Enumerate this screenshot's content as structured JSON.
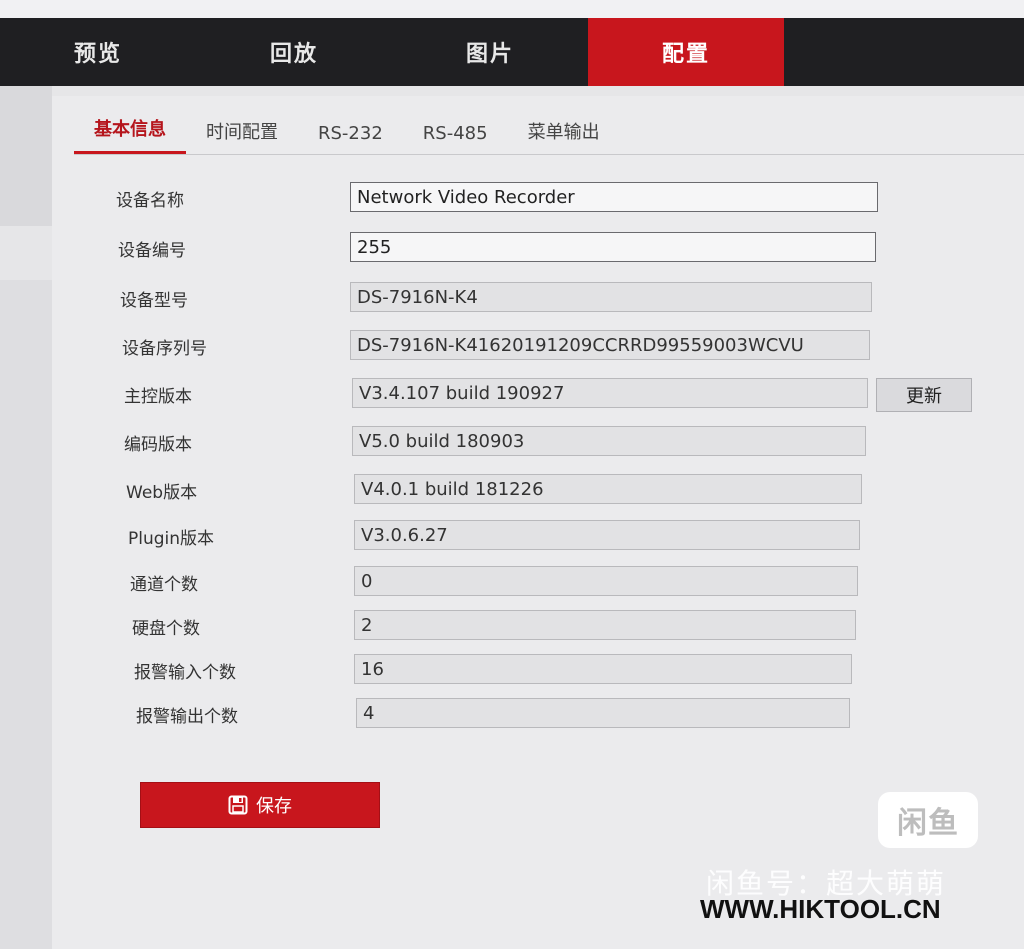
{
  "top_nav": {
    "items": [
      {
        "label": "预览",
        "active": false
      },
      {
        "label": "回放",
        "active": false
      },
      {
        "label": "图片",
        "active": false
      },
      {
        "label": "配置",
        "active": true
      }
    ]
  },
  "sub_tabs": [
    {
      "label": "基本信息",
      "active": true
    },
    {
      "label": "时间配置",
      "active": false
    },
    {
      "label": "RS-232",
      "active": false
    },
    {
      "label": "RS-485",
      "active": false
    },
    {
      "label": "菜单输出",
      "active": false
    }
  ],
  "form": {
    "rows": [
      {
        "label": "设备名称",
        "value": "Network Video Recorder",
        "editable": true
      },
      {
        "label": "设备编号",
        "value": "255",
        "editable": true
      },
      {
        "label": "设备型号",
        "value": "DS-7916N-K4",
        "editable": false
      },
      {
        "label": "设备序列号",
        "value": "DS-7916N-K41620191209CCRRD99559003WCVU",
        "editable": false
      },
      {
        "label": "主控版本",
        "value": "V3.4.107 build 190927",
        "editable": false
      },
      {
        "label": "编码版本",
        "value": "V5.0 build 180903",
        "editable": false
      },
      {
        "label": "Web版本",
        "value": "V4.0.1 build 181226",
        "editable": false
      },
      {
        "label": "Plugin版本",
        "value": "V3.0.6.27",
        "editable": false
      },
      {
        "label": "通道个数",
        "value": "0",
        "editable": false
      },
      {
        "label": "硬盘个数",
        "value": "2",
        "editable": false
      },
      {
        "label": "报警输入个数",
        "value": "16",
        "editable": false
      },
      {
        "label": "报警输出个数",
        "value": "4",
        "editable": false
      }
    ],
    "update_label": "更新"
  },
  "save_label": "保存",
  "watermark": {
    "badge": "闲鱼",
    "line": "闲鱼号：超大萌萌",
    "url": "WWW.HIKTOOL.CN"
  },
  "colors": {
    "accent": "#c8161d",
    "nav_bg": "#1f1f22",
    "content_bg": "#ebebed"
  }
}
